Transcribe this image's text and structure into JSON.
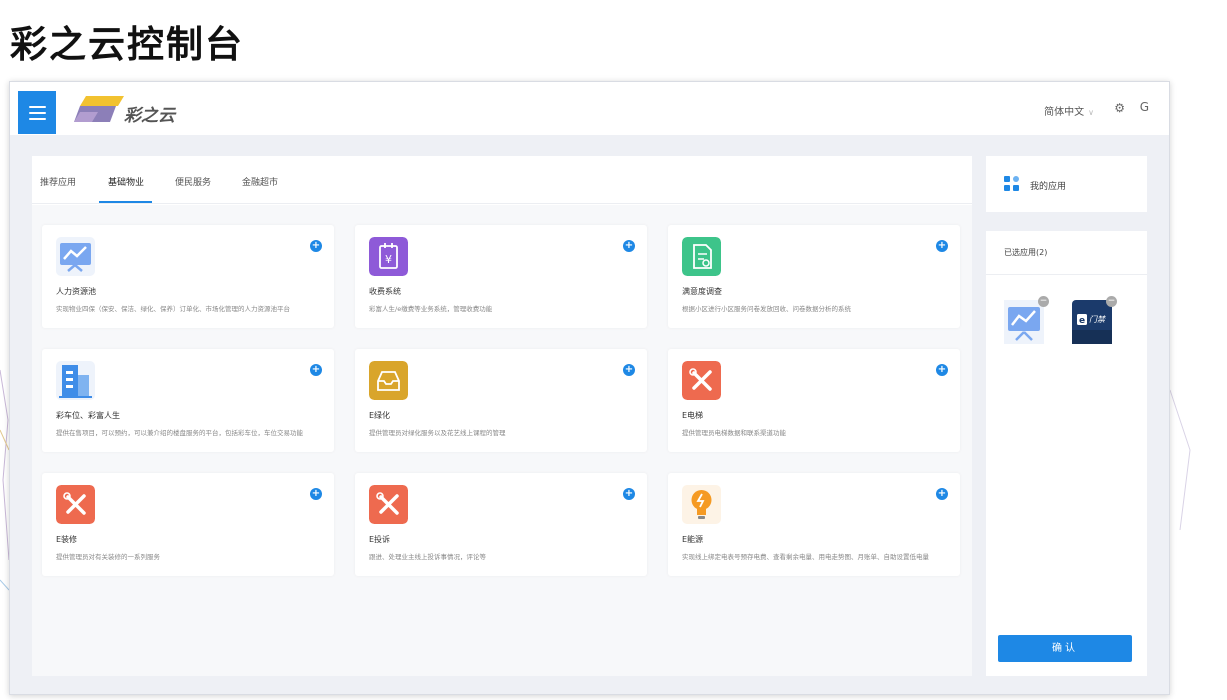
{
  "slide_title": "彩之云控制台",
  "header": {
    "logo_text": "彩之云",
    "language": "简体中文",
    "settings_icon": "gear-icon",
    "logout_icon": "power-icon"
  },
  "tabs": [
    {
      "label": "推荐应用",
      "active": false
    },
    {
      "label": "基础物业",
      "active": true
    },
    {
      "label": "便民服务",
      "active": false
    },
    {
      "label": "金融超市",
      "active": false
    }
  ],
  "apps": [
    {
      "name": "人力资源池",
      "desc": "实现物业四保（保安、保洁、绿化、保养）订单化、市场化管理的人力资源池平台",
      "icon": "chart-board-icon",
      "color": "#7aa7f0"
    },
    {
      "name": "收费系统",
      "desc": "彩富人生/e缴费等业务系统，管理收费功能",
      "icon": "yen-doc-icon",
      "color": "#8e5ad8"
    },
    {
      "name": "满意度调查",
      "desc": "根据小区进行小区服务问卷发放回收、问卷数据分析的系统",
      "icon": "survey-icon",
      "color": "#3dc48a"
    },
    {
      "name": "彩车位、彩富人生",
      "desc": "提供在售项目，可以预约，可以兼介绍的楼盘服务的平台，包括彩车位，车位交易功能",
      "icon": "building-icon",
      "color": "#3f8de8"
    },
    {
      "name": "E绿化",
      "desc": "提供管理员对绿化服务以及花艺线上课程的管理",
      "icon": "inbox-icon",
      "color": "#d9a52b"
    },
    {
      "name": "E电梯",
      "desc": "提供管理员电梯数据和联系渠道功能",
      "icon": "tools-icon",
      "color": "#ee6a4f"
    },
    {
      "name": "E装修",
      "desc": "提供管理员对有关装修的一系列服务",
      "icon": "tools-icon",
      "color": "#ee6a4f"
    },
    {
      "name": "E投诉",
      "desc": "跟进、处理业主线上投诉事情况，评论等",
      "icon": "tools-icon",
      "color": "#ee6a4f"
    },
    {
      "name": "E能源",
      "desc": "实现线上绑定电表号预存电费、查看剩余电量、用电走势图、月账单、自助设置低电量",
      "icon": "bulb-icon",
      "color": "#f59a23"
    }
  ],
  "sidebar": {
    "my_apps_label": "我的应用",
    "selected_label": "已选应用(2)",
    "selected_apps": [
      {
        "icon": "chart-board-icon"
      },
      {
        "icon": "door-access-icon",
        "label": "门禁"
      }
    ],
    "confirm_label": "确认"
  },
  "colors": {
    "accent": "#1e88e5",
    "frame_bg": "#eef0f5"
  }
}
